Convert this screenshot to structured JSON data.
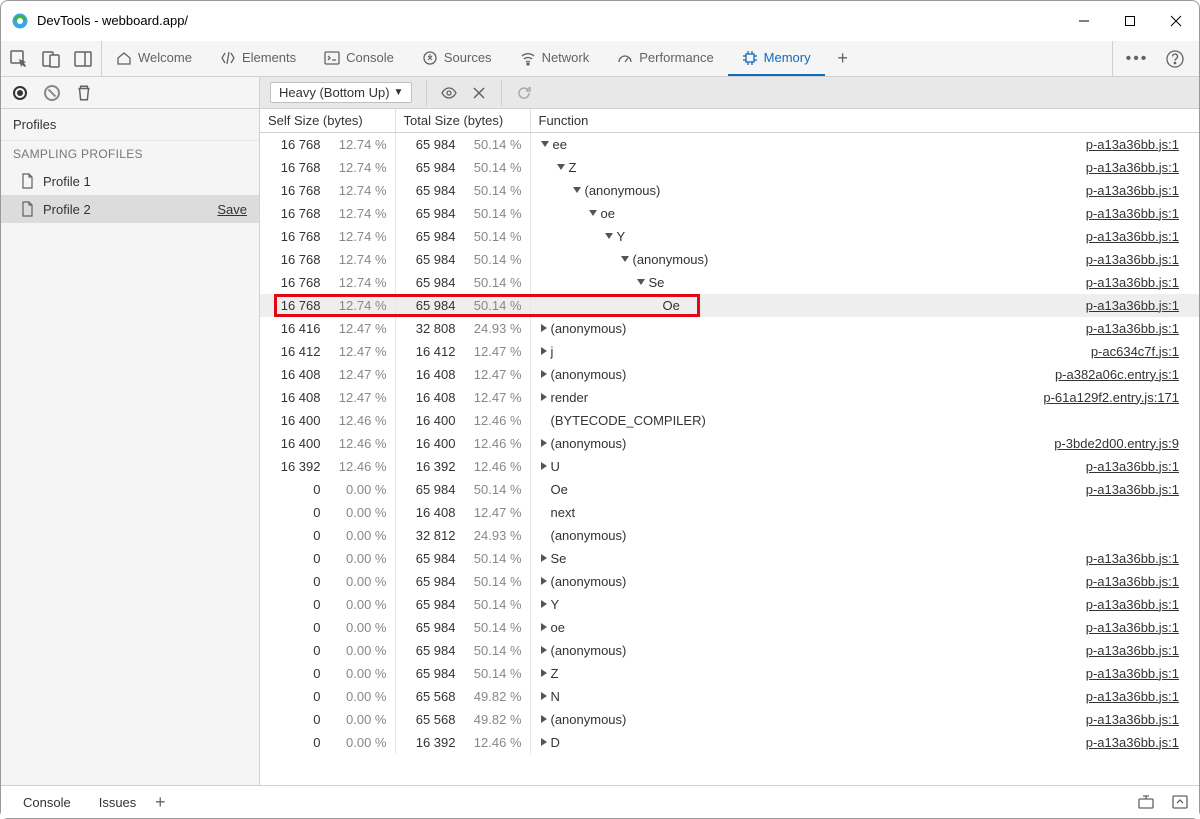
{
  "window": {
    "title": "DevTools - webboard.app/"
  },
  "tabs": {
    "welcome": "Welcome",
    "elements": "Elements",
    "console": "Console",
    "sources": "Sources",
    "network": "Network",
    "performance": "Performance",
    "memory": "Memory"
  },
  "sidebar": {
    "title": "Profiles",
    "section": "SAMPLING PROFILES",
    "items": [
      {
        "label": "Profile 1",
        "selected": false,
        "save": false
      },
      {
        "label": "Profile 2",
        "selected": true,
        "save": true,
        "save_label": "Save"
      }
    ]
  },
  "content_toolbar": {
    "dropdown": "Heavy (Bottom Up)"
  },
  "columns": {
    "self": "Self Size (bytes)",
    "total": "Total Size (bytes)",
    "fn": "Function"
  },
  "rows": [
    {
      "self": "16 768",
      "self_pct": "12.74 %",
      "total": "65 984",
      "total_pct": "50.14 %",
      "indent": 0,
      "open": true,
      "name": "ee",
      "src": "p-a13a36bb.js:1"
    },
    {
      "self": "16 768",
      "self_pct": "12.74 %",
      "total": "65 984",
      "total_pct": "50.14 %",
      "indent": 1,
      "open": true,
      "name": "Z",
      "src": "p-a13a36bb.js:1"
    },
    {
      "self": "16 768",
      "self_pct": "12.74 %",
      "total": "65 984",
      "total_pct": "50.14 %",
      "indent": 2,
      "open": true,
      "name": "(anonymous)",
      "src": "p-a13a36bb.js:1"
    },
    {
      "self": "16 768",
      "self_pct": "12.74 %",
      "total": "65 984",
      "total_pct": "50.14 %",
      "indent": 3,
      "open": true,
      "name": "oe",
      "src": "p-a13a36bb.js:1"
    },
    {
      "self": "16 768",
      "self_pct": "12.74 %",
      "total": "65 984",
      "total_pct": "50.14 %",
      "indent": 4,
      "open": true,
      "name": "Y",
      "src": "p-a13a36bb.js:1"
    },
    {
      "self": "16 768",
      "self_pct": "12.74 %",
      "total": "65 984",
      "total_pct": "50.14 %",
      "indent": 5,
      "open": true,
      "name": "(anonymous)",
      "src": "p-a13a36bb.js:1"
    },
    {
      "self": "16 768",
      "self_pct": "12.74 %",
      "total": "65 984",
      "total_pct": "50.14 %",
      "indent": 6,
      "open": true,
      "name": "Se",
      "src": "p-a13a36bb.js:1"
    },
    {
      "self": "16 768",
      "self_pct": "12.74 %",
      "total": "65 984",
      "total_pct": "50.14 %",
      "indent": 7,
      "open": null,
      "name": "Oe",
      "src": "p-a13a36bb.js:1",
      "hl": true,
      "boxed": true
    },
    {
      "self": "16 416",
      "self_pct": "12.47 %",
      "total": "32 808",
      "total_pct": "24.93 %",
      "indent": 0,
      "open": false,
      "name": "(anonymous)",
      "src": "p-a13a36bb.js:1"
    },
    {
      "self": "16 412",
      "self_pct": "12.47 %",
      "total": "16 412",
      "total_pct": "12.47 %",
      "indent": 0,
      "open": false,
      "name": "j",
      "src": "p-ac634c7f.js:1"
    },
    {
      "self": "16 408",
      "self_pct": "12.47 %",
      "total": "16 408",
      "total_pct": "12.47 %",
      "indent": 0,
      "open": false,
      "name": "(anonymous)",
      "src": "p-a382a06c.entry.js:1"
    },
    {
      "self": "16 408",
      "self_pct": "12.47 %",
      "total": "16 408",
      "total_pct": "12.47 %",
      "indent": 0,
      "open": false,
      "name": "render",
      "src": "p-61a129f2.entry.js:171"
    },
    {
      "self": "16 400",
      "self_pct": "12.46 %",
      "total": "16 400",
      "total_pct": "12.46 %",
      "indent": 0,
      "open": null,
      "name": "(BYTECODE_COMPILER)",
      "src": ""
    },
    {
      "self": "16 400",
      "self_pct": "12.46 %",
      "total": "16 400",
      "total_pct": "12.46 %",
      "indent": 0,
      "open": false,
      "name": "(anonymous)",
      "src": "p-3bde2d00.entry.js:9"
    },
    {
      "self": "16 392",
      "self_pct": "12.46 %",
      "total": "16 392",
      "total_pct": "12.46 %",
      "indent": 0,
      "open": false,
      "name": "U",
      "src": "p-a13a36bb.js:1"
    },
    {
      "self": "0",
      "self_pct": "0.00 %",
      "total": "65 984",
      "total_pct": "50.14 %",
      "indent": 0,
      "open": null,
      "name": "Oe",
      "src": "p-a13a36bb.js:1"
    },
    {
      "self": "0",
      "self_pct": "0.00 %",
      "total": "16 408",
      "total_pct": "12.47 %",
      "indent": 0,
      "open": null,
      "name": "next",
      "src": ""
    },
    {
      "self": "0",
      "self_pct": "0.00 %",
      "total": "32 812",
      "total_pct": "24.93 %",
      "indent": 0,
      "open": null,
      "name": "(anonymous)",
      "src": ""
    },
    {
      "self": "0",
      "self_pct": "0.00 %",
      "total": "65 984",
      "total_pct": "50.14 %",
      "indent": 0,
      "open": false,
      "name": "Se",
      "src": "p-a13a36bb.js:1"
    },
    {
      "self": "0",
      "self_pct": "0.00 %",
      "total": "65 984",
      "total_pct": "50.14 %",
      "indent": 0,
      "open": false,
      "name": "(anonymous)",
      "src": "p-a13a36bb.js:1"
    },
    {
      "self": "0",
      "self_pct": "0.00 %",
      "total": "65 984",
      "total_pct": "50.14 %",
      "indent": 0,
      "open": false,
      "name": "Y",
      "src": "p-a13a36bb.js:1"
    },
    {
      "self": "0",
      "self_pct": "0.00 %",
      "total": "65 984",
      "total_pct": "50.14 %",
      "indent": 0,
      "open": false,
      "name": "oe",
      "src": "p-a13a36bb.js:1"
    },
    {
      "self": "0",
      "self_pct": "0.00 %",
      "total": "65 984",
      "total_pct": "50.14 %",
      "indent": 0,
      "open": false,
      "name": "(anonymous)",
      "src": "p-a13a36bb.js:1"
    },
    {
      "self": "0",
      "self_pct": "0.00 %",
      "total": "65 984",
      "total_pct": "50.14 %",
      "indent": 0,
      "open": false,
      "name": "Z",
      "src": "p-a13a36bb.js:1"
    },
    {
      "self": "0",
      "self_pct": "0.00 %",
      "total": "65 568",
      "total_pct": "49.82 %",
      "indent": 0,
      "open": false,
      "name": "N",
      "src": "p-a13a36bb.js:1"
    },
    {
      "self": "0",
      "self_pct": "0.00 %",
      "total": "65 568",
      "total_pct": "49.82 %",
      "indent": 0,
      "open": false,
      "name": "(anonymous)",
      "src": "p-a13a36bb.js:1"
    },
    {
      "self": "0",
      "self_pct": "0.00 %",
      "total": "16 392",
      "total_pct": "12.46 %",
      "indent": 0,
      "open": false,
      "name": "D",
      "src": "p-a13a36bb.js:1"
    }
  ],
  "drawer": {
    "console": "Console",
    "issues": "Issues"
  }
}
